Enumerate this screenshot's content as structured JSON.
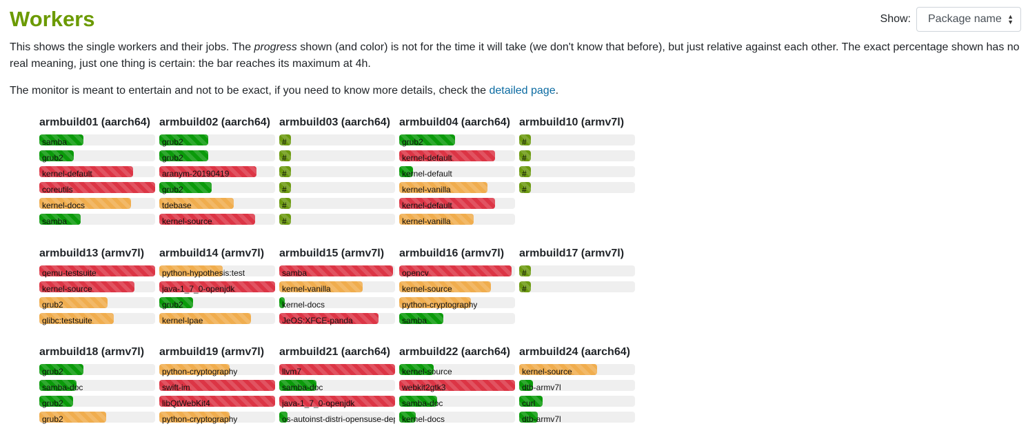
{
  "title": "Workers",
  "show": {
    "label": "Show:",
    "selected": "Package name"
  },
  "intro": {
    "p1a": "This shows the single workers and their jobs. The ",
    "p1em": "progress",
    "p1b": " shown (and color) is not for the time it will take (we don't know that before), but just relative against each other. The exact percentage shown has no real meaning, just one thing is certain: the bar reaches its maximum at 4h.",
    "p2a": "The monitor is meant to entertain and not to be exact, if you need to know more details, check the ",
    "p2link": "detailed page",
    "p2b": "."
  },
  "colors": {
    "green": "#0a9a0a",
    "red": "#dc3545",
    "orange": "#f0ad4e",
    "olive": "#6c9a10"
  },
  "rows": [
    [
      {
        "name": "armbuild01 (aarch64)",
        "jobs": [
          [
            "samba",
            0.38,
            "green"
          ],
          [
            "grub2",
            0.3,
            "green"
          ],
          [
            "kernel-default",
            0.81,
            "red"
          ],
          [
            "coreutils",
            1.0,
            "red"
          ],
          [
            "kernel-docs",
            0.79,
            "orange"
          ],
          [
            "samba",
            0.36,
            "green"
          ]
        ]
      },
      {
        "name": "armbuild02 (aarch64)",
        "jobs": [
          [
            "grub2",
            0.42,
            "green"
          ],
          [
            "grub2",
            0.42,
            "green"
          ],
          [
            "aranym-20190419",
            0.84,
            "red"
          ],
          [
            "grub2",
            0.45,
            "green"
          ],
          [
            "tdebase",
            0.64,
            "orange"
          ],
          [
            "kernel-source",
            0.83,
            "red"
          ]
        ]
      },
      {
        "name": "armbuild03 (aarch64)",
        "jobs": [
          [
            "#",
            0.1,
            "olive"
          ],
          [
            "#",
            0.1,
            "olive"
          ],
          [
            "#",
            0.1,
            "olive"
          ],
          [
            "#",
            0.1,
            "olive"
          ],
          [
            "#",
            0.1,
            "olive"
          ],
          [
            "#",
            0.1,
            "olive"
          ]
        ]
      },
      {
        "name": "armbuild04 (aarch64)",
        "jobs": [
          [
            "grub2",
            0.48,
            "green"
          ],
          [
            "kernel-default",
            0.83,
            "red"
          ],
          [
            "kernel-default",
            0.12,
            "green"
          ],
          [
            "kernel-vanilla",
            0.76,
            "orange"
          ],
          [
            "kernel-default",
            0.83,
            "red"
          ],
          [
            "kernel-vanilla",
            0.64,
            "orange"
          ]
        ]
      },
      {
        "name": "armbuild10 (armv7l)",
        "jobs": [
          [
            "#",
            0.1,
            "olive"
          ],
          [
            "#",
            0.1,
            "olive"
          ],
          [
            "#",
            0.1,
            "olive"
          ],
          [
            "#",
            0.1,
            "olive"
          ]
        ]
      }
    ],
    [
      {
        "name": "armbuild13 (armv7l)",
        "jobs": [
          [
            "qemu-testsuite",
            1.0,
            "red"
          ],
          [
            "kernel-source",
            0.82,
            "red"
          ],
          [
            "grub2",
            0.59,
            "orange"
          ],
          [
            "glibc:testsuite",
            0.64,
            "orange"
          ]
        ]
      },
      {
        "name": "armbuild14 (armv7l)",
        "jobs": [
          [
            "python-hypothesis:test",
            0.55,
            "orange"
          ],
          [
            "java-1_7_0-openjdk",
            1.0,
            "red"
          ],
          [
            "grub2",
            0.29,
            "green"
          ],
          [
            "kernel-lpae",
            0.79,
            "orange"
          ]
        ]
      },
      {
        "name": "armbuild15 (armv7l)",
        "jobs": [
          [
            "samba",
            0.98,
            "red"
          ],
          [
            "kernel-vanilla",
            0.72,
            "orange"
          ],
          [
            "kernel-docs",
            0.05,
            "green"
          ],
          [
            "JeOS:XFCE-panda",
            0.86,
            "red"
          ]
        ]
      },
      {
        "name": "armbuild16 (armv7l)",
        "jobs": [
          [
            "opencv",
            0.97,
            "red"
          ],
          [
            "kernel-source",
            0.79,
            "orange"
          ],
          [
            "python-cryptography",
            0.62,
            "orange"
          ],
          [
            "samba",
            0.38,
            "green"
          ]
        ]
      },
      {
        "name": "armbuild17 (armv7l)",
        "jobs": [
          [
            "#",
            0.1,
            "olive"
          ],
          [
            "#",
            0.1,
            "olive"
          ]
        ]
      }
    ],
    [
      {
        "name": "armbuild18 (armv7l)",
        "jobs": [
          [
            "grub2",
            0.38,
            "green"
          ],
          [
            "samba-doc",
            0.32,
            "green"
          ],
          [
            "grub2",
            0.29,
            "green"
          ],
          [
            "grub2",
            0.58,
            "orange"
          ]
        ]
      },
      {
        "name": "armbuild19 (armv7l)",
        "jobs": [
          [
            "python-cryptography",
            0.61,
            "orange"
          ],
          [
            "swift-im",
            1.0,
            "red"
          ],
          [
            "libQtWebKit4",
            1.0,
            "red"
          ],
          [
            "python-cryptography",
            0.61,
            "orange"
          ]
        ]
      },
      {
        "name": "armbuild21 (aarch64)",
        "jobs": [
          [
            "llvm7",
            1.0,
            "red"
          ],
          [
            "samba-doc",
            0.32,
            "green"
          ],
          [
            "java-1_7_0-openjdk",
            1.0,
            "red"
          ],
          [
            "os-autoinst-distri-opensuse-deps",
            0.07,
            "green"
          ]
        ]
      },
      {
        "name": "armbuild22 (aarch64)",
        "jobs": [
          [
            "kernel-source",
            0.3,
            "green"
          ],
          [
            "webkit2gtk3",
            1.0,
            "red"
          ],
          [
            "samba-doc",
            0.33,
            "green"
          ],
          [
            "kernel-docs",
            0.14,
            "green"
          ]
        ]
      },
      {
        "name": "armbuild24 (aarch64)",
        "jobs": [
          [
            "kernel-source",
            0.67,
            "orange"
          ],
          [
            "dtb-armv7l",
            0.12,
            "green"
          ],
          [
            "curl",
            0.2,
            "green"
          ],
          [
            "dtb-armv7l",
            0.16,
            "green"
          ]
        ]
      }
    ]
  ]
}
